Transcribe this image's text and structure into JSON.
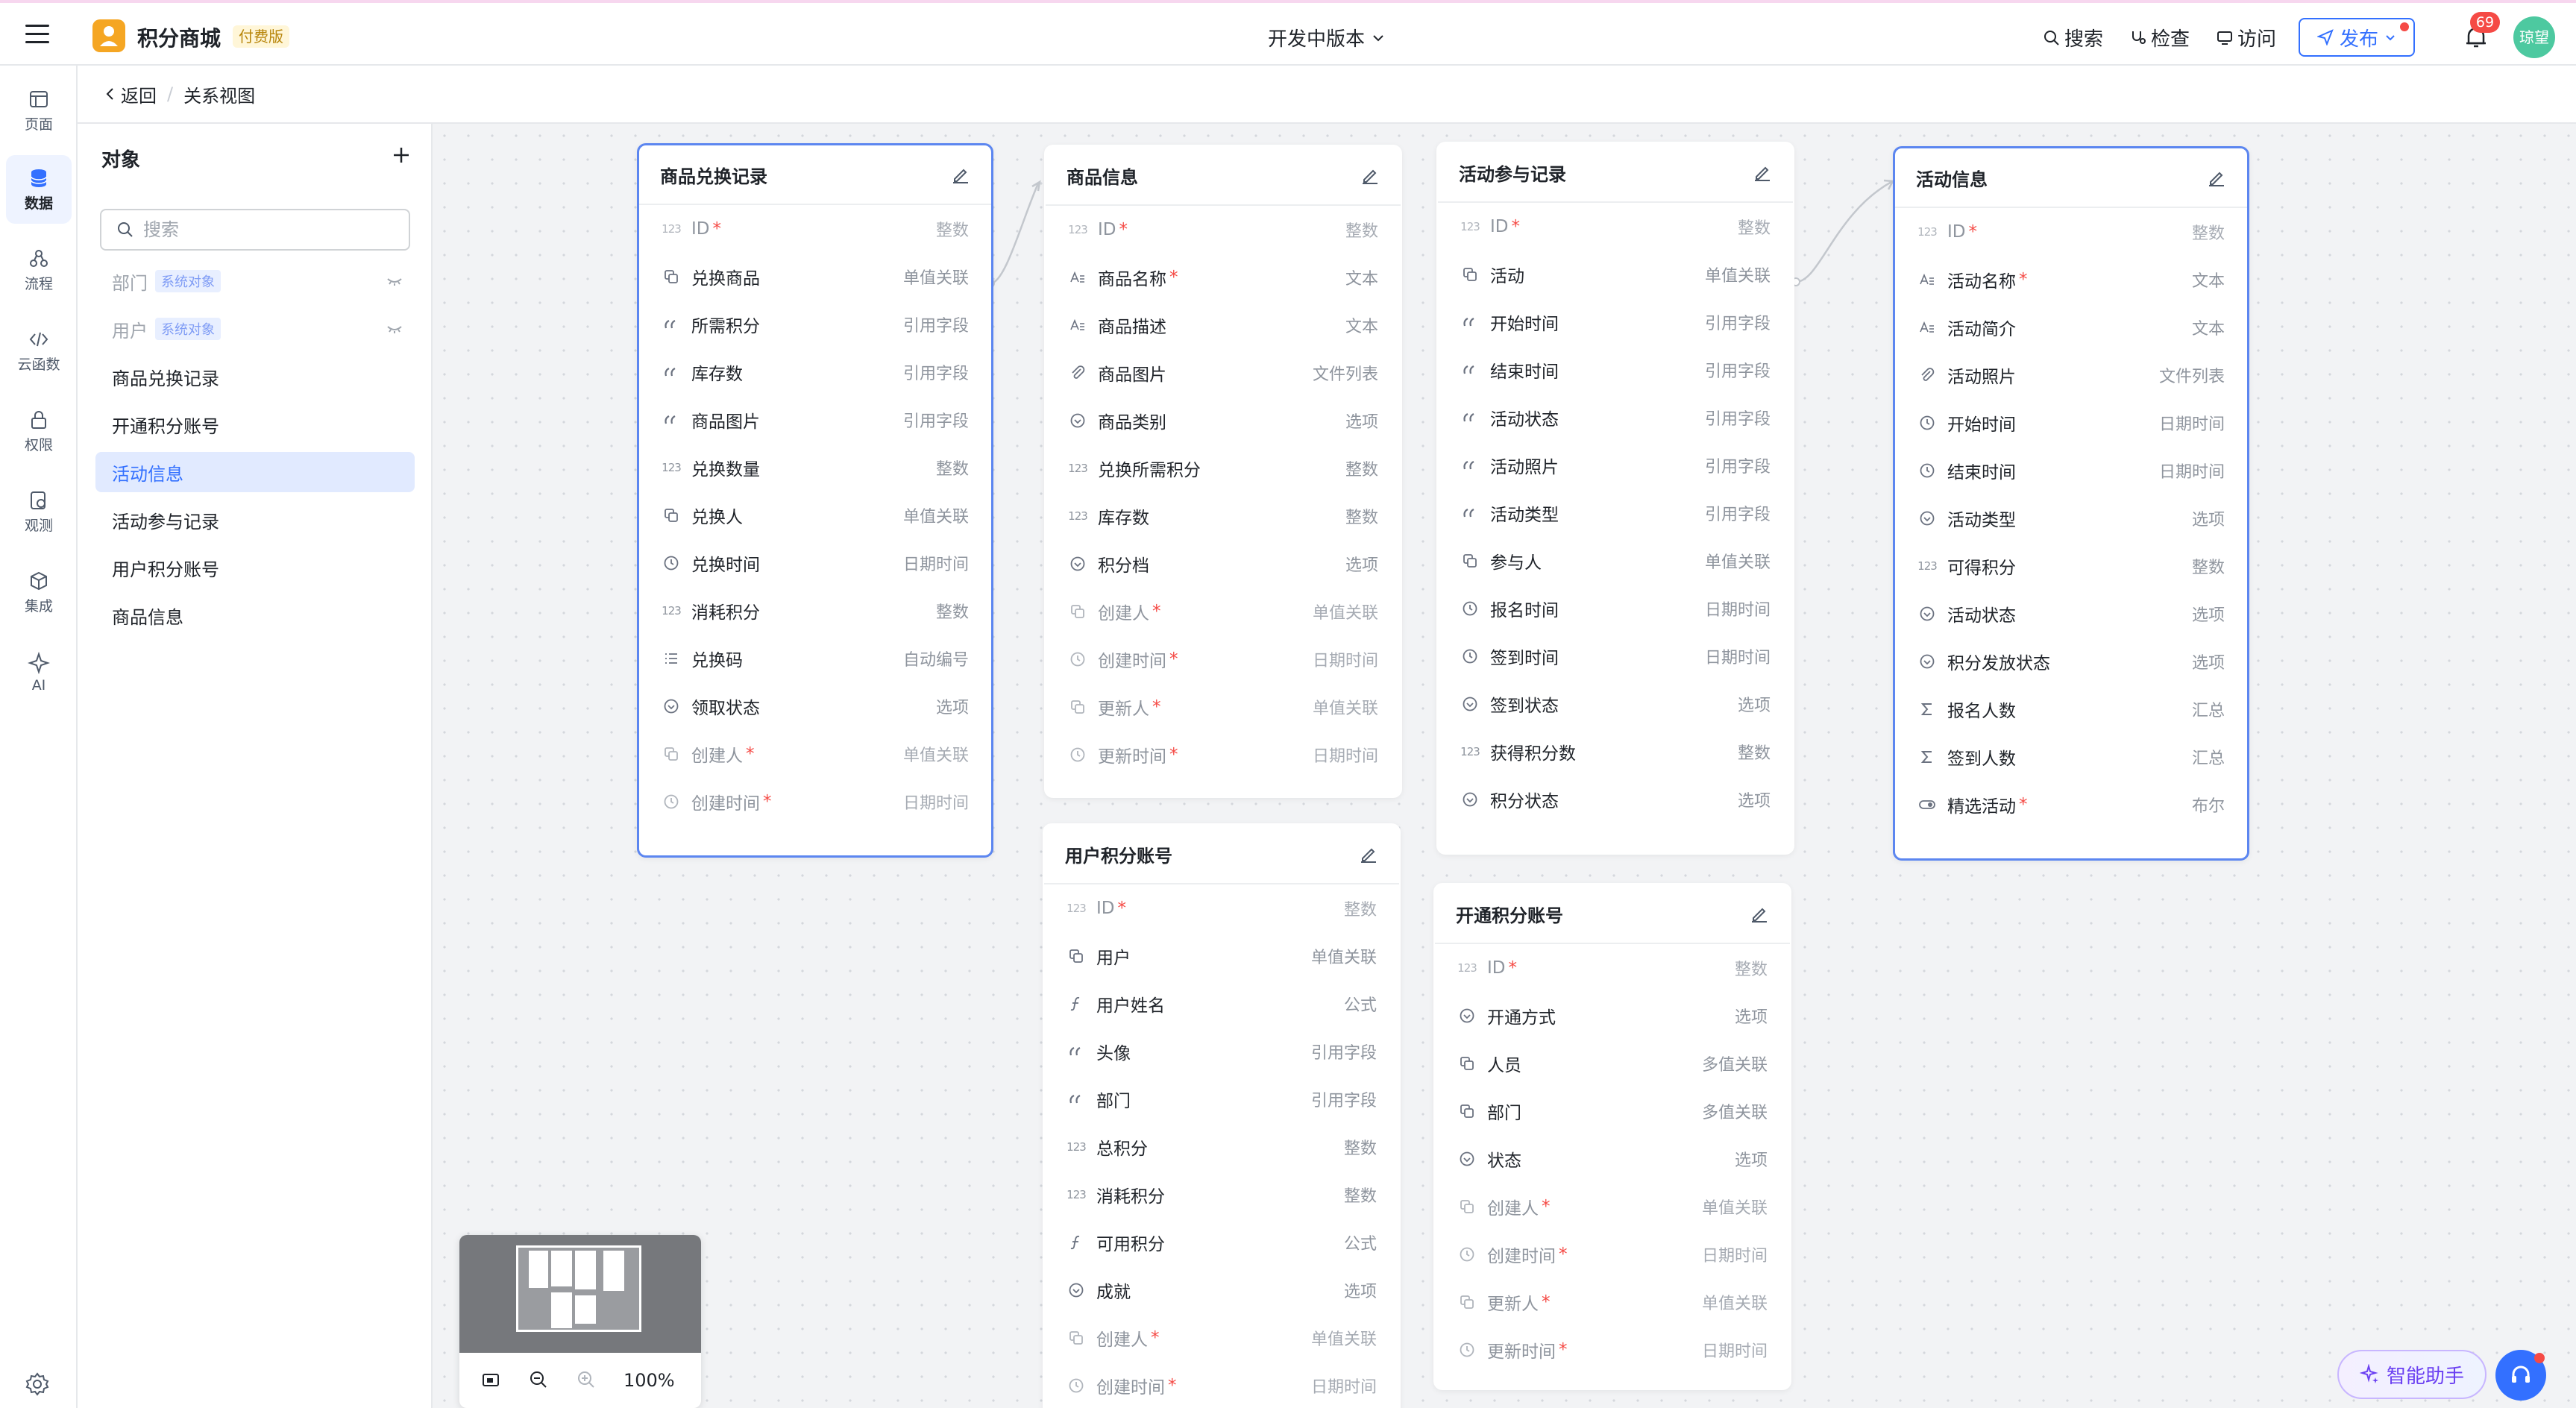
{
  "topbar": {
    "app_title": "积分商城",
    "plan_badge": "付费版",
    "version_label": "开发中版本",
    "search_label": "搜索",
    "inspect_label": "检查",
    "visit_label": "访问",
    "publish_label": "发布",
    "notification_count": "69",
    "avatar_text": "琼望"
  },
  "rail": {
    "items": [
      {
        "label": "页面",
        "icon": "page-icon"
      },
      {
        "label": "数据",
        "icon": "database-icon"
      },
      {
        "label": "流程",
        "icon": "flow-icon"
      },
      {
        "label": "云函数",
        "icon": "code-icon"
      },
      {
        "label": "权限",
        "icon": "lock-icon"
      },
      {
        "label": "观测",
        "icon": "monitor-icon"
      },
      {
        "label": "集成",
        "icon": "cube-icon"
      },
      {
        "label": "AI",
        "icon": "sparkle-icon"
      }
    ],
    "active": "数据"
  },
  "breadcrumb": {
    "back": "返回",
    "separator": "/",
    "current": "关系视图"
  },
  "objects": {
    "title": "对象",
    "search_placeholder": "搜索",
    "items": [
      {
        "label": "部门",
        "tag": "系统对象"
      },
      {
        "label": "用户",
        "tag": "系统对象"
      },
      {
        "label": "商品兑换记录"
      },
      {
        "label": "开通积分账号"
      },
      {
        "label": "活动信息"
      },
      {
        "label": "活动参与记录"
      },
      {
        "label": "用户积分账号"
      },
      {
        "label": "商品信息"
      }
    ],
    "active": "活动信息"
  },
  "cards": [
    {
      "title": "商品兑换记录",
      "fields": [
        {
          "name": "ID",
          "type": "整数",
          "req": "*",
          "icon": "number-icon",
          "sys": true
        },
        {
          "name": "兑换商品",
          "type": "单值关联",
          "icon": "link-icon"
        },
        {
          "name": "所需积分",
          "type": "引用字段",
          "icon": "quote-icon"
        },
        {
          "name": "库存数",
          "type": "引用字段",
          "icon": "quote-icon"
        },
        {
          "name": "商品图片",
          "type": "引用字段",
          "icon": "quote-icon"
        },
        {
          "name": "兑换数量",
          "type": "整数",
          "icon": "number-icon"
        },
        {
          "name": "兑换人",
          "type": "单值关联",
          "icon": "link-icon"
        },
        {
          "name": "兑换时间",
          "type": "日期时间",
          "icon": "clock-icon"
        },
        {
          "name": "消耗积分",
          "type": "整数",
          "icon": "number-icon"
        },
        {
          "name": "兑换码",
          "type": "自动编号",
          "icon": "list-icon"
        },
        {
          "name": "领取状态",
          "type": "选项",
          "icon": "option-icon"
        },
        {
          "name": "创建人",
          "type": "单值关联",
          "req": "*",
          "icon": "link-icon",
          "sys": true
        },
        {
          "name": "创建时间",
          "type": "日期时间",
          "req": "*",
          "icon": "clock-icon",
          "sys": true
        }
      ]
    },
    {
      "title": "商品信息",
      "fields": [
        {
          "name": "ID",
          "type": "整数",
          "req": "*",
          "icon": "number-icon",
          "sys": true
        },
        {
          "name": "商品名称",
          "type": "文本",
          "req": "*",
          "icon": "text-icon"
        },
        {
          "name": "商品描述",
          "type": "文本",
          "icon": "text-icon"
        },
        {
          "name": "商品图片",
          "type": "文件列表",
          "icon": "attachment-icon"
        },
        {
          "name": "商品类别",
          "type": "选项",
          "icon": "option-icon"
        },
        {
          "name": "兑换所需积分",
          "type": "整数",
          "icon": "number-icon"
        },
        {
          "name": "库存数",
          "type": "整数",
          "icon": "number-icon"
        },
        {
          "name": "积分档",
          "type": "选项",
          "icon": "option-icon"
        },
        {
          "name": "创建人",
          "type": "单值关联",
          "req": "*",
          "icon": "link-icon",
          "sys": true
        },
        {
          "name": "创建时间",
          "type": "日期时间",
          "req": "*",
          "icon": "clock-icon",
          "sys": true
        },
        {
          "name": "更新人",
          "type": "单值关联",
          "req": "*",
          "icon": "link-icon",
          "sys": true
        },
        {
          "name": "更新时间",
          "type": "日期时间",
          "req": "*",
          "icon": "clock-icon",
          "sys": true
        }
      ]
    },
    {
      "title": "活动参与记录",
      "fields": [
        {
          "name": "ID",
          "type": "整数",
          "req": "*",
          "icon": "number-icon",
          "sys": true
        },
        {
          "name": "活动",
          "type": "单值关联",
          "icon": "link-icon"
        },
        {
          "name": "开始时间",
          "type": "引用字段",
          "icon": "quote-icon"
        },
        {
          "name": "结束时间",
          "type": "引用字段",
          "icon": "quote-icon"
        },
        {
          "name": "活动状态",
          "type": "引用字段",
          "icon": "quote-icon"
        },
        {
          "name": "活动照片",
          "type": "引用字段",
          "icon": "quote-icon"
        },
        {
          "name": "活动类型",
          "type": "引用字段",
          "icon": "quote-icon"
        },
        {
          "name": "参与人",
          "type": "单值关联",
          "icon": "link-icon"
        },
        {
          "name": "报名时间",
          "type": "日期时间",
          "icon": "clock-icon"
        },
        {
          "name": "签到时间",
          "type": "日期时间",
          "icon": "clock-icon"
        },
        {
          "name": "签到状态",
          "type": "选项",
          "icon": "option-icon"
        },
        {
          "name": "获得积分数",
          "type": "整数",
          "icon": "number-icon"
        },
        {
          "name": "积分状态",
          "type": "选项",
          "icon": "option-icon"
        }
      ]
    },
    {
      "title": "活动信息",
      "fields": [
        {
          "name": "ID",
          "type": "整数",
          "req": "*",
          "icon": "number-icon",
          "sys": true
        },
        {
          "name": "活动名称",
          "type": "文本",
          "req": "*",
          "icon": "text-icon"
        },
        {
          "name": "活动简介",
          "type": "文本",
          "icon": "text-icon"
        },
        {
          "name": "活动照片",
          "type": "文件列表",
          "icon": "attachment-icon"
        },
        {
          "name": "开始时间",
          "type": "日期时间",
          "icon": "clock-icon"
        },
        {
          "name": "结束时间",
          "type": "日期时间",
          "icon": "clock-icon"
        },
        {
          "name": "活动类型",
          "type": "选项",
          "icon": "option-icon"
        },
        {
          "name": "可得积分",
          "type": "整数",
          "icon": "number-icon"
        },
        {
          "name": "活动状态",
          "type": "选项",
          "icon": "option-icon"
        },
        {
          "name": "积分发放状态",
          "type": "选项",
          "icon": "option-icon"
        },
        {
          "name": "报名人数",
          "type": "汇总",
          "icon": "sum-icon"
        },
        {
          "name": "签到人数",
          "type": "汇总",
          "icon": "sum-icon"
        },
        {
          "name": "精选活动",
          "type": "布尔",
          "req": "*",
          "icon": "toggle-icon"
        }
      ]
    },
    {
      "title": "用户积分账号",
      "fields": [
        {
          "name": "ID",
          "type": "整数",
          "req": "*",
          "icon": "number-icon",
          "sys": true
        },
        {
          "name": "用户",
          "type": "单值关联",
          "icon": "link-icon"
        },
        {
          "name": "用户姓名",
          "type": "公式",
          "icon": "formula-icon"
        },
        {
          "name": "头像",
          "type": "引用字段",
          "icon": "quote-icon"
        },
        {
          "name": "部门",
          "type": "引用字段",
          "icon": "quote-icon"
        },
        {
          "name": "总积分",
          "type": "整数",
          "icon": "number-icon"
        },
        {
          "name": "消耗积分",
          "type": "整数",
          "icon": "number-icon"
        },
        {
          "name": "可用积分",
          "type": "公式",
          "icon": "formula-icon"
        },
        {
          "name": "成就",
          "type": "选项",
          "icon": "option-icon"
        },
        {
          "name": "创建人",
          "type": "单值关联",
          "req": "*",
          "icon": "link-icon",
          "sys": true
        },
        {
          "name": "创建时间",
          "type": "日期时间",
          "req": "*",
          "icon": "clock-icon",
          "sys": true
        }
      ]
    },
    {
      "title": "开通积分账号",
      "fields": [
        {
          "name": "ID",
          "type": "整数",
          "req": "*",
          "icon": "number-icon",
          "sys": true
        },
        {
          "name": "开通方式",
          "type": "选项",
          "icon": "option-icon"
        },
        {
          "name": "人员",
          "type": "多值关联",
          "icon": "link-icon"
        },
        {
          "name": "部门",
          "type": "多值关联",
          "icon": "link-icon"
        },
        {
          "name": "状态",
          "type": "选项",
          "icon": "option-icon"
        },
        {
          "name": "创建人",
          "type": "单值关联",
          "req": "*",
          "icon": "link-icon",
          "sys": true
        },
        {
          "name": "创建时间",
          "type": "日期时间",
          "req": "*",
          "icon": "clock-icon",
          "sys": true
        },
        {
          "name": "更新人",
          "type": "单值关联",
          "req": "*",
          "icon": "link-icon",
          "sys": true
        },
        {
          "name": "更新时间",
          "type": "日期时间",
          "req": "*",
          "icon": "clock-icon",
          "sys": true
        }
      ]
    }
  ],
  "selected_card": "活动信息",
  "minimap": {
    "zoom": "100%"
  },
  "assistant": {
    "label": "智能助手"
  },
  "colors": {
    "accent": "#3370ff",
    "required": "#f54a45",
    "selected_border": "#5c86f0",
    "active_item_bg": "#e1eaff"
  }
}
